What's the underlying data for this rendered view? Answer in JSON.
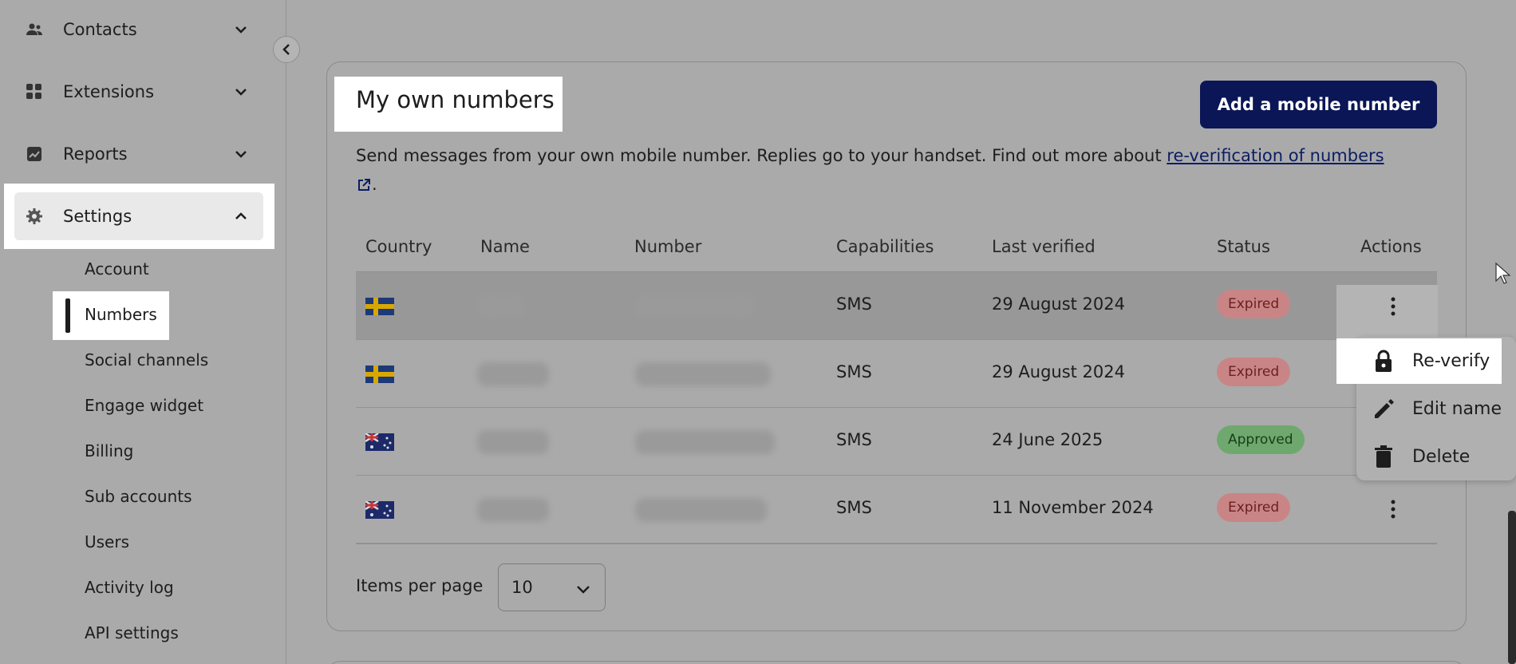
{
  "sidebar": {
    "groups": [
      {
        "label": "Contacts"
      },
      {
        "label": "Extensions"
      },
      {
        "label": "Reports"
      }
    ],
    "settings": {
      "label": "Settings"
    },
    "sub_items": [
      "Account",
      "Numbers",
      "Social channels",
      "Engage widget",
      "Billing",
      "Sub accounts",
      "Users",
      "Activity log",
      "API settings"
    ]
  },
  "card": {
    "title": "My own numbers",
    "add_button": "Add a mobile number",
    "description": "Send messages from your own mobile number. Replies go to your handset. Find out more about",
    "link_text": "re-verification of numbers",
    "period": "."
  },
  "table": {
    "headers": [
      "Country",
      "Name",
      "Number",
      "Capabilities",
      "Last verified",
      "Status",
      "Actions"
    ],
    "rows": [
      {
        "country": "SE",
        "capabilities": "SMS",
        "last_verified": "29 August 2024",
        "status": "Expired"
      },
      {
        "country": "SE",
        "capabilities": "SMS",
        "last_verified": "29 August 2024",
        "status": "Expired"
      },
      {
        "country": "AU",
        "capabilities": "SMS",
        "last_verified": "24 June 2025",
        "status": "Approved"
      },
      {
        "country": "AU",
        "capabilities": "SMS",
        "last_verified": "11 November 2024",
        "status": "Expired"
      }
    ]
  },
  "menu": {
    "items": [
      {
        "label": "Re-verify",
        "icon": "lock-icon"
      },
      {
        "label": "Edit name",
        "icon": "pencil-icon"
      },
      {
        "label": "Delete",
        "icon": "trash-icon"
      }
    ]
  },
  "pagination": {
    "label": "Items per page",
    "value": "10"
  },
  "colors": {
    "primary_button": "#0a1656",
    "expired": "#c98585",
    "approved": "#6fa86f"
  }
}
